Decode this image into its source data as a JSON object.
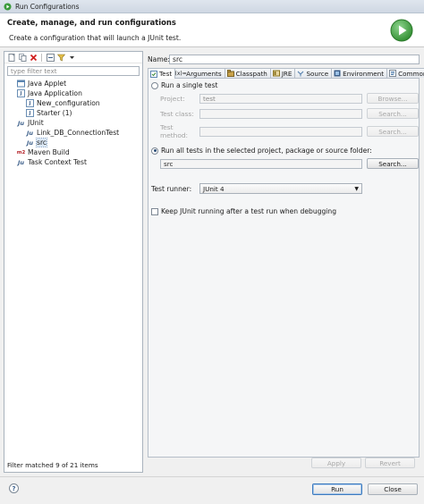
{
  "window": {
    "title": "Run Configurations"
  },
  "header": {
    "title": "Create, manage, and run configurations",
    "subtitle": "Create a configuration that will launch a JUnit test."
  },
  "left": {
    "filter_placeholder": "type filter text",
    "tree": [
      {
        "label": "Java Applet",
        "level": 0,
        "icon": "java-applet-icon"
      },
      {
        "label": "Java Application",
        "level": 0,
        "icon": "java-application-icon"
      },
      {
        "label": "New_configuration",
        "level": 1,
        "icon": "java-config-icon"
      },
      {
        "label": "Starter (1)",
        "level": 1,
        "icon": "java-config-icon"
      },
      {
        "label": "JUnit",
        "level": 0,
        "icon": "junit-icon"
      },
      {
        "label": "Link_DB_ConnectionTest",
        "level": 1,
        "icon": "junit-config-icon"
      },
      {
        "label": "src",
        "level": 1,
        "icon": "junit-config-icon",
        "selected": true
      },
      {
        "label": "Maven Build",
        "level": 0,
        "icon": "maven-icon"
      },
      {
        "label": "Task Context Test",
        "level": 0,
        "icon": "junit-icon"
      }
    ],
    "status": "Filter matched 9 of 21 items"
  },
  "right": {
    "name_label": "Name:",
    "name_value": "src",
    "tabs": [
      {
        "label": "Test",
        "icon": "test-icon",
        "active": true
      },
      {
        "label": "Arguments",
        "icon": "arguments-icon"
      },
      {
        "label": "Classpath",
        "icon": "classpath-icon"
      },
      {
        "label": "JRE",
        "icon": "jre-icon"
      },
      {
        "label": "Source",
        "icon": "source-icon"
      },
      {
        "label": "Environment",
        "icon": "environment-icon"
      },
      {
        "label": "Common",
        "icon": "common-icon"
      }
    ],
    "single_test": {
      "label": "Run a single test",
      "project_label": "Project:",
      "project_value": "test",
      "browse": "Browse...",
      "class_label": "Test class:",
      "class_value": "",
      "search": "Search...",
      "method_label": "Test method:",
      "method_value": ""
    },
    "all_tests": {
      "label": "Run all tests in the selected project, package or source folder:",
      "value": "src",
      "search": "Search..."
    },
    "runner": {
      "label": "Test runner:",
      "value": "JUnit 4"
    },
    "keep_alive": {
      "label": "Keep JUnit running after a test run when debugging",
      "checked": false
    },
    "apply": "Apply",
    "revert": "Revert"
  },
  "footer": {
    "help": "?",
    "run": "Run",
    "close": "Close"
  }
}
